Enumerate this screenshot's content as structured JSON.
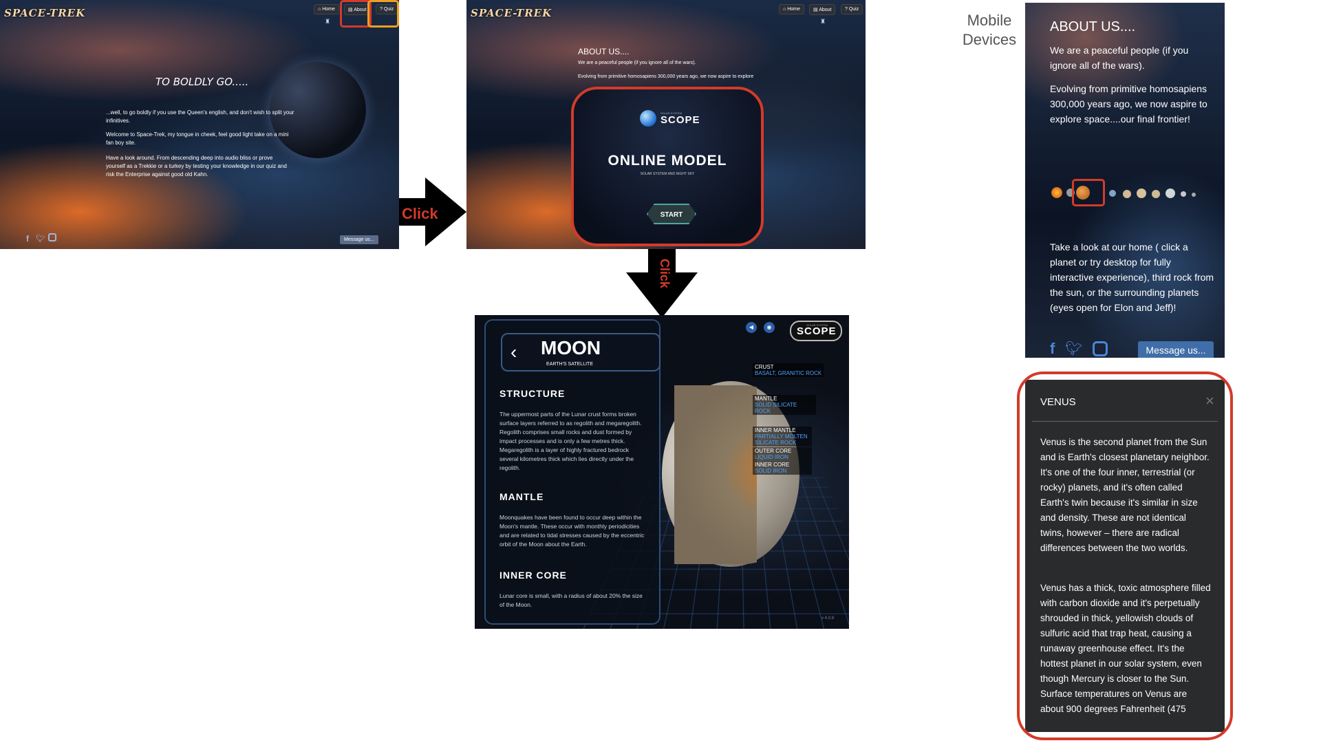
{
  "screen1": {
    "logo": "SPACE-TREK",
    "nav": {
      "home": "Home",
      "about": "About",
      "quiz": "Quiz"
    },
    "heading": "TO BOLDLY GO.....",
    "p1": "...well, to go boldly if you use the Queen's english, and don't wish to split your infinitives.",
    "p2": "Welcome to Space-Trek, my tongue in cheek, feel good light take on a mini fan boy site.",
    "p3": "Have a look around. From descending deep into audio bliss or prove yourself as a Trekkie or a turkey by testing your knowledge in our quiz and risk the Enterprise against good old Kahn.",
    "message_btn": "Message us..."
  },
  "arrow_right_label": "Click",
  "screen2": {
    "logo": "SPACE-TREK",
    "nav": {
      "home": "Home",
      "about": "About",
      "quiz": "Quiz"
    },
    "heading": "ABOUT US....",
    "p1": "We are a peaceful people (if you ignore all of the wars).",
    "p2": "Evolving from primitive homosapiens 300,000 years ago, we now aspire to explore",
    "p2b": "explore",
    "modal": {
      "brand_small": "SOLAR SYSTEM",
      "brand": "SCOPE",
      "title": "ONLINE MODEL",
      "subtitle": "SOLAR SYSTEM AND NIGHT SKY",
      "start": "START"
    }
  },
  "arrow_down_label": "Click",
  "moon": {
    "title": "MOON",
    "subtitle": "EARTH'S SATELLITE",
    "structure_h": "STRUCTURE",
    "structure_p": "The uppermost parts of the Lunar crust forms broken surface layers referred to as regolith and megaregolith. Regolith comprises small rocks and dust formed by impact processes and is only a few metres thick. Megaregolith is a layer of highly fractured bedrock several kilometres thick which lies directly under the regolith.",
    "mantle_h": "MANTLE",
    "mantle_p": "Moonquakes have been found to occur deep within the Moon's mantle. These occur with monthly periodicities and are related to tidal stresses caused by the eccentric orbit of the Moon about the Earth.",
    "core_h": "INNER CORE",
    "core_p": "Lunar core is small, with a radius of about 20% the size of the Moon.",
    "brand_small": "SOLAR SYSTEM",
    "brand": "SCOPE",
    "layers": [
      {
        "name": "CRUST",
        "desc": "BASALT, GRANITIC ROCK"
      },
      {
        "name": "MANTLE",
        "desc": "SOLID SILICATE ROCK"
      },
      {
        "name": "INNER MANTLE",
        "desc": "PARTIALLY MOLTEN SILICATE ROCK"
      },
      {
        "name": "OUTER CORE",
        "desc": "LIQUID IRON"
      },
      {
        "name": "INNER CORE",
        "desc": "SOLID IRON"
      }
    ],
    "version": "v 4.0.9"
  },
  "mobile_label": "Mobile\nDevices",
  "mobile1": {
    "heading": "ABOUT US....",
    "p1": "We are a peaceful people (if you ignore all of the wars).",
    "p2": "Evolving from primitive homosapiens 300,000 years ago, we now aspire to explore space....our final frontier!",
    "p3": "Take a look at our home ( click a planet or try desktop for fully interactive experience), third rock from the sun, or the surrounding planets (eyes open for Elon and Jeff)!",
    "message_btn": "Message us..."
  },
  "venus": {
    "title": "VENUS",
    "close": "×",
    "p1": "Venus is the second planet from the Sun and is Earth's closest planetary neighbor. It's one of the four inner, terrestrial (or rocky) planets, and it's often called Earth's twin because it's similar in size and density. These are not identical twins, however – there are radical differences between the two worlds.",
    "p2": "Venus has a thick, toxic atmosphere filled with carbon dioxide and it's perpetually shrouded in thick, yellowish clouds of sulfuric acid that trap heat, causing a runaway greenhouse effect. It's the hottest planet in our solar system, even though Mercury is closer to the Sun. Surface temperatures on Venus are about 900 degrees Fahrenheit (475"
  }
}
